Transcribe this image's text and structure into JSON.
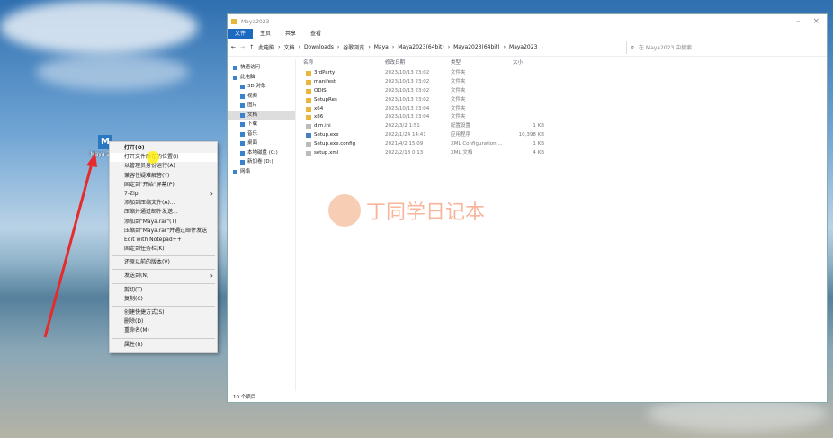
{
  "desktop": {
    "icon_label": "Maya 2023"
  },
  "context_menu": {
    "items": [
      "打开(O)",
      "打开文件所在的位置(I)",
      "以管理员身份运行(A)",
      "兼容性疑难解答(Y)",
      "固定到\"开始\"屏幕(P)",
      "7-Zip",
      "添加到压缩文件(A)...",
      "压缩并通过邮件发送...",
      "添加到\"Maya.rar\"(T)",
      "压缩到\"Maya.rar\"并通过邮件发送",
      "Edit with Notepad++",
      "固定到任务栏(K)",
      "还原以前的版本(V)",
      "发送到(N)",
      "剪切(T)",
      "复制(C)",
      "创建快捷方式(S)",
      "删除(D)",
      "重命名(M)",
      "属性(R)"
    ]
  },
  "explorer": {
    "title": "Maya2023",
    "ribbon_tabs": [
      "文件",
      "主页",
      "共享",
      "查看"
    ],
    "breadcrumb": [
      "此电脑",
      "文档",
      "Downloads",
      "谷歌浏览",
      "Maya",
      "Maya2023(64bit)",
      "Maya2023(64bit)",
      "Maya2023"
    ],
    "search_placeholder": "在 Maya2023 中搜索",
    "nav": [
      {
        "label": "快速访问",
        "sub": false
      },
      {
        "label": "此电脑",
        "sub": false
      },
      {
        "label": "3D 对象",
        "sub": true
      },
      {
        "label": "视频",
        "sub": true
      },
      {
        "label": "图片",
        "sub": true
      },
      {
        "label": "文档",
        "sub": true,
        "selected": true
      },
      {
        "label": "下载",
        "sub": true
      },
      {
        "label": "音乐",
        "sub": true
      },
      {
        "label": "桌面",
        "sub": true
      },
      {
        "label": "本地磁盘 (C:)",
        "sub": true
      },
      {
        "label": "新加卷 (D:)",
        "sub": true
      },
      {
        "label": "网络",
        "sub": false
      }
    ],
    "columns": [
      "名称",
      "修改日期",
      "类型",
      "大小"
    ],
    "files": [
      {
        "name": "3rdParty",
        "date": "2023/10/13 23:02",
        "type": "文件夹",
        "size": "",
        "kind": "folder"
      },
      {
        "name": "manifest",
        "date": "2023/10/13 23:02",
        "type": "文件夹",
        "size": "",
        "kind": "folder"
      },
      {
        "name": "ODIS",
        "date": "2023/10/13 23:02",
        "type": "文件夹",
        "size": "",
        "kind": "folder"
      },
      {
        "name": "SetupRes",
        "date": "2023/10/13 23:02",
        "type": "文件夹",
        "size": "",
        "kind": "folder"
      },
      {
        "name": "x64",
        "date": "2023/10/13 23:04",
        "type": "文件夹",
        "size": "",
        "kind": "folder"
      },
      {
        "name": "x86",
        "date": "2023/10/13 23:04",
        "type": "文件夹",
        "size": "",
        "kind": "folder"
      },
      {
        "name": "dlm.ini",
        "date": "2022/3/2 1:51",
        "type": "配置设置",
        "size": "1 KB",
        "kind": "file"
      },
      {
        "name": "Setup.exe",
        "date": "2022/1/24 14:41",
        "type": "应用程序",
        "size": "10,398 KB",
        "kind": "exe"
      },
      {
        "name": "Setup.exe.config",
        "date": "2021/4/2 15:09",
        "type": "XML Configuration ...",
        "size": "1 KB",
        "kind": "file"
      },
      {
        "name": "setup.xml",
        "date": "2022/2/18 0:13",
        "type": "XML 文档",
        "size": "4 KB",
        "kind": "file"
      }
    ],
    "status": "10 个项目"
  },
  "watermark": "丁同学日记本"
}
